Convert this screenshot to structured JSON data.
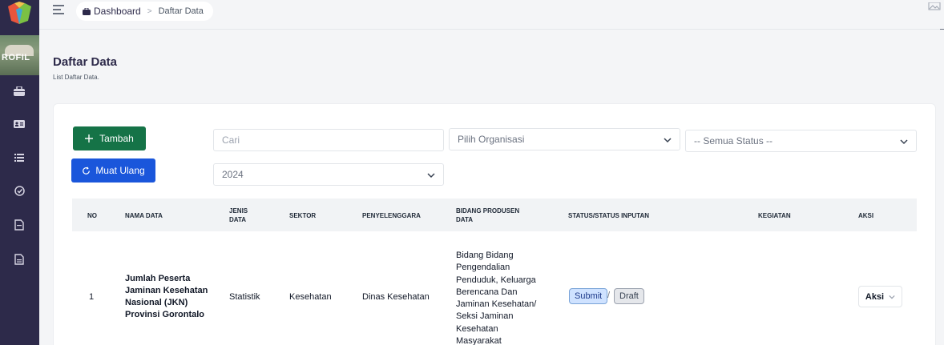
{
  "sidebar": {
    "banner_text": "ROFIL",
    "icons": [
      "briefcase-icon",
      "id-card-icon",
      "list-icon",
      "check-circle-icon",
      "file-icon",
      "file-alt-icon"
    ]
  },
  "breadcrumb": {
    "home": "Dashboard",
    "current": "Daftar Data"
  },
  "header": {
    "title": "Daftar Data",
    "subtitle": "List Daftar Data."
  },
  "toolbar": {
    "add_label": "Tambah",
    "reload_label": "Muat Ulang",
    "search_placeholder": "Cari",
    "org_select": "Pilih Organisasi",
    "status_select": "-- Semua Status --",
    "year_select": "2024"
  },
  "table": {
    "headers": {
      "no": "NO",
      "nama": "NAMA DATA",
      "jenis": "JENIS DATA",
      "sektor": "SEKTOR",
      "penyelenggara": "PENYELENGGARA",
      "bidang": "BIDANG PRODUSEN DATA",
      "status": "STATUS/STATUS INPUTAN",
      "kegiatan": "KEGIATAN",
      "aksi": "AKSI"
    },
    "rows": [
      {
        "no": "1",
        "nama": "Jumlah Peserta Jaminan Kesehatan Nasional (JKN) Provinsi Gorontalo",
        "jenis": "Statistik",
        "sektor": "Kesehatan",
        "penyelenggara": "Dinas Kesehatan",
        "bidang": "Bidang Bidang Pengendalian Penduduk, Keluarga Berencana Dan Jaminan Kesehatan/ Seksi Jaminan Kesehatan Masyarakat",
        "status": "Submit",
        "status_sep": "/",
        "status_input": "Draft",
        "kegiatan": "",
        "aksi": "Aksi"
      }
    ]
  },
  "colors": {
    "sidebar": "#2d2a4a",
    "add_button": "#157347",
    "reload_button": "#1a56db",
    "submit_badge": "#cfe2ff"
  }
}
